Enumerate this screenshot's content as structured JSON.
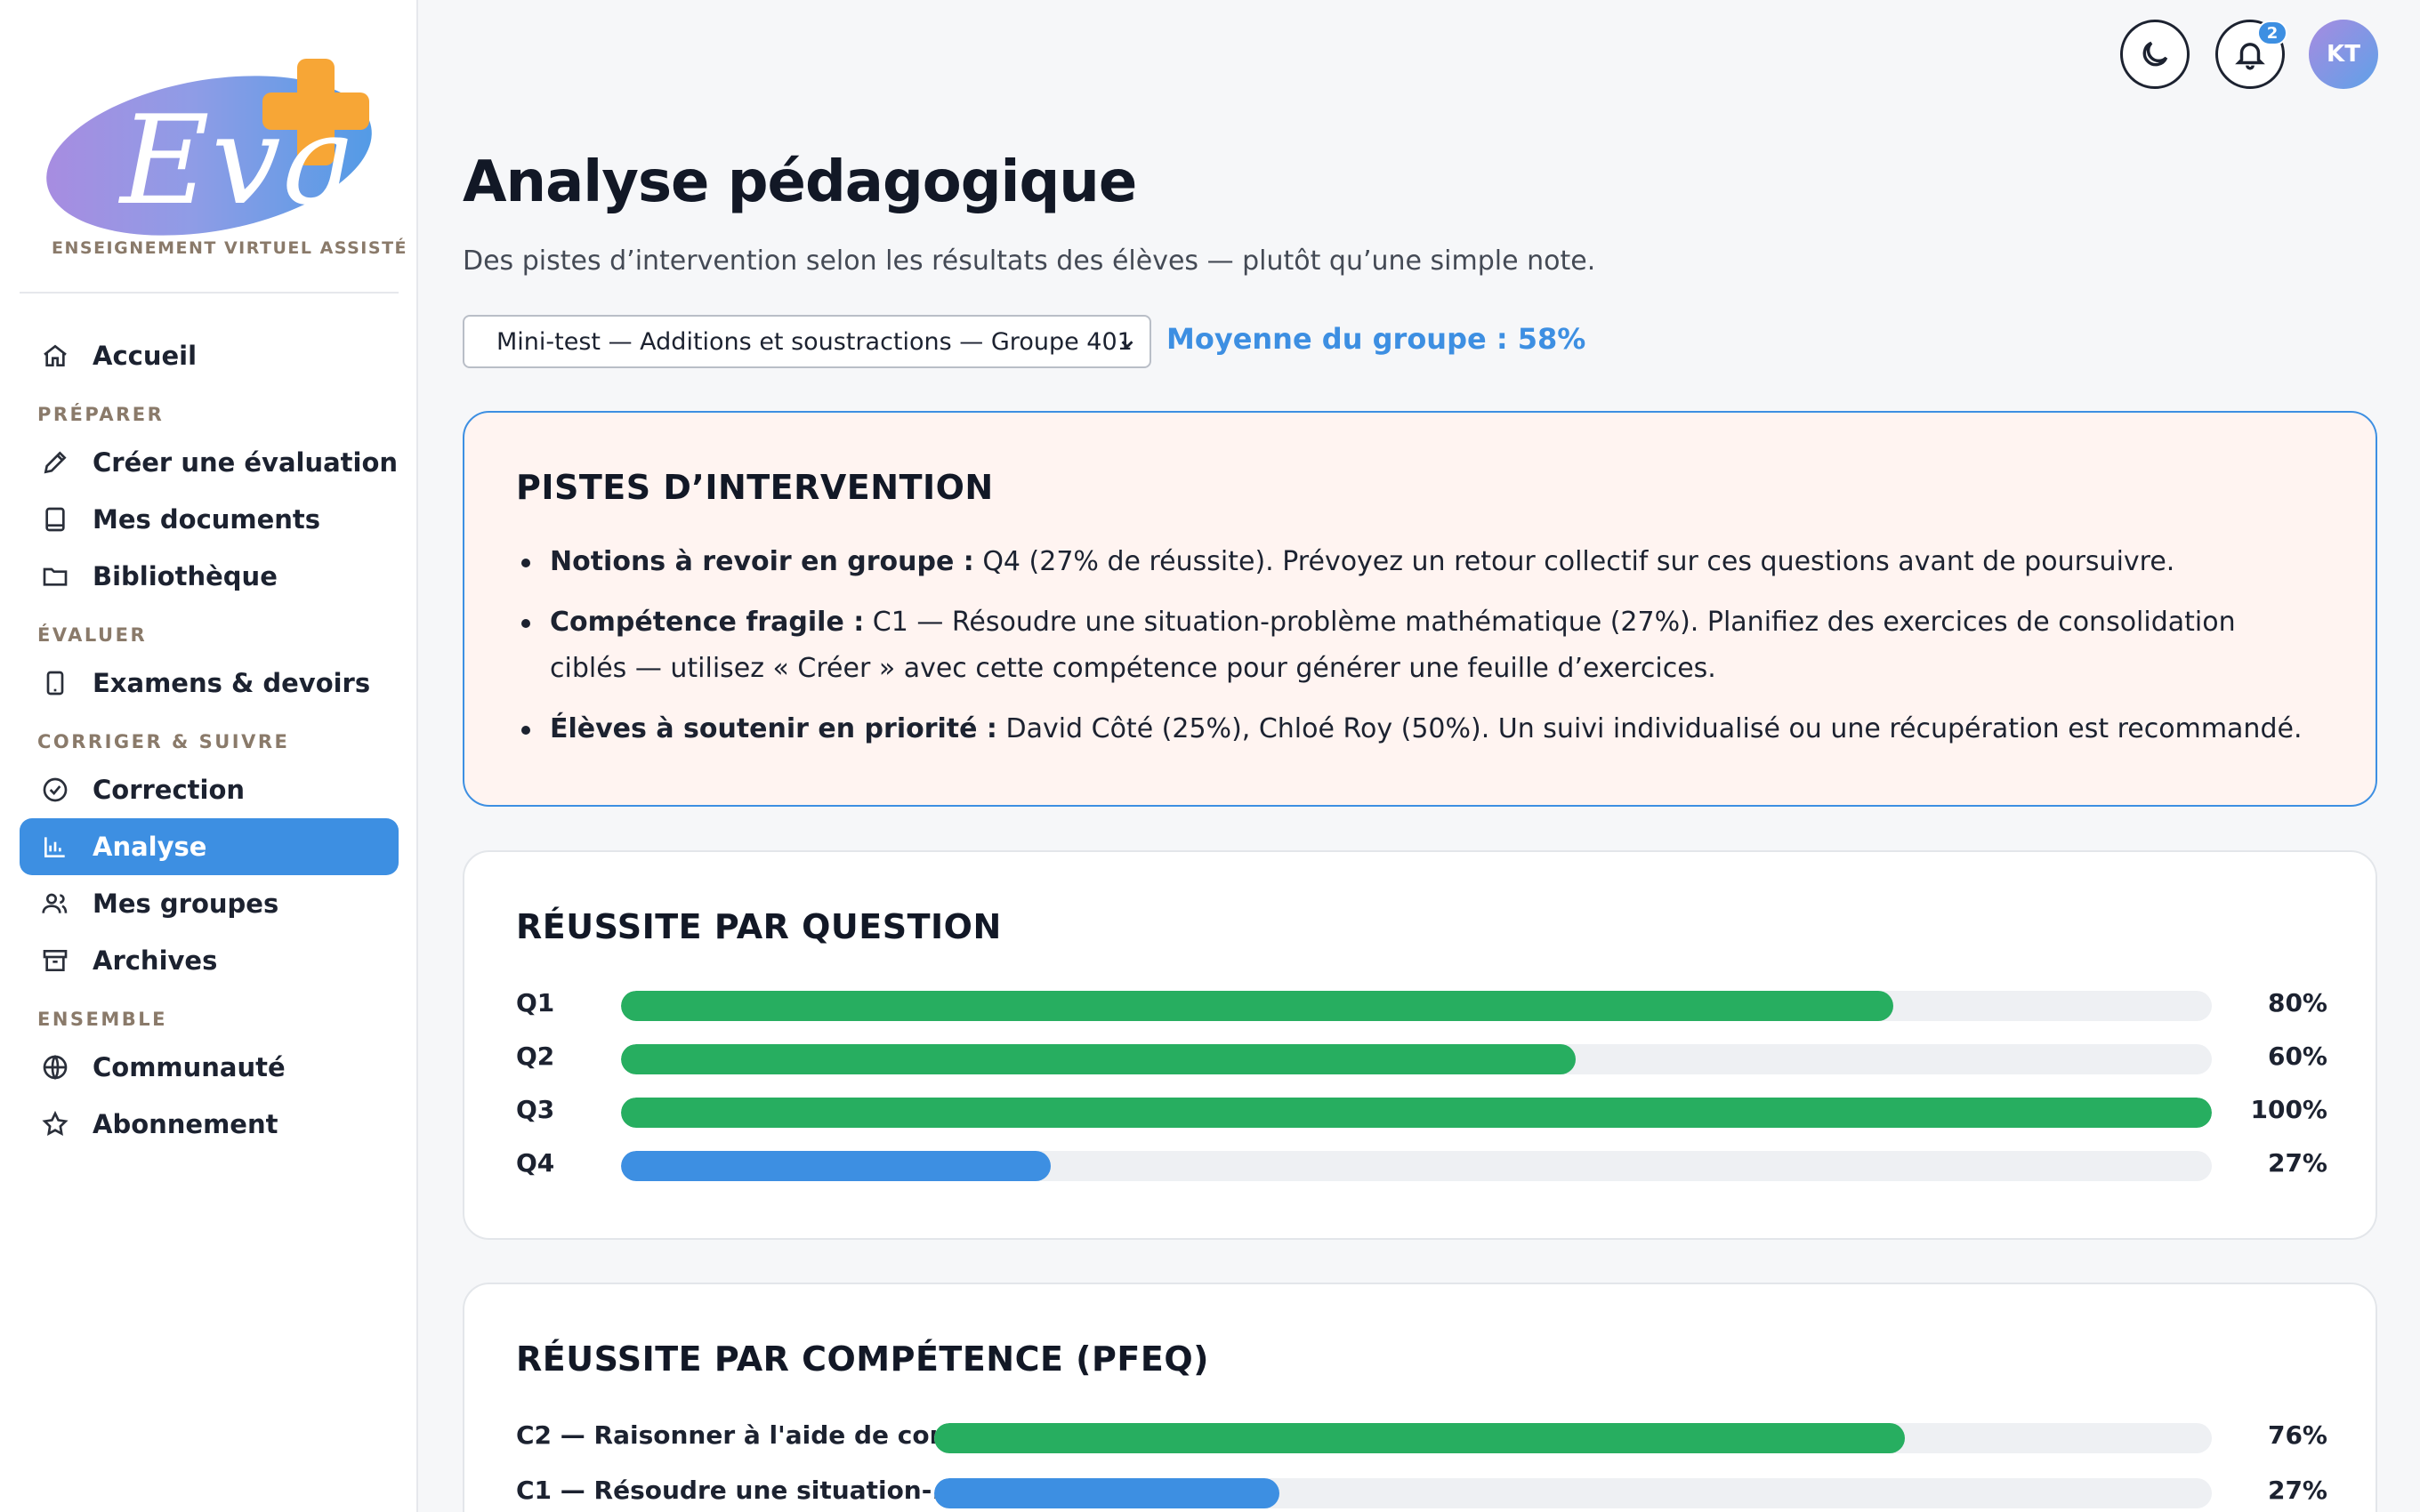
{
  "brand": {
    "logo_text": "Eva",
    "tagline": "ENSEIGNEMENT VIRTUEL ASSISTÉ"
  },
  "colors": {
    "accent": "#3d8fe2",
    "success": "#27ae60",
    "hint_bg": "#fff4f1"
  },
  "sidebar": {
    "home": {
      "label": "Accueil",
      "icon": "home-icon"
    },
    "sections": [
      {
        "title": "PRÉPARER",
        "items": [
          {
            "label": "Créer une évaluation",
            "icon": "pencil-icon"
          },
          {
            "label": "Mes documents",
            "icon": "book-icon"
          },
          {
            "label": "Bibliothèque",
            "icon": "folder-icon"
          }
        ]
      },
      {
        "title": "ÉVALUER",
        "items": [
          {
            "label": "Examens & devoirs",
            "icon": "tablet-icon"
          }
        ]
      },
      {
        "title": "CORRIGER & SUIVRE",
        "items": [
          {
            "label": "Correction",
            "icon": "check-circle-icon"
          },
          {
            "label": "Analyse",
            "icon": "bar-chart-icon",
            "active": true
          },
          {
            "label": "Mes groupes",
            "icon": "users-icon"
          },
          {
            "label": "Archives",
            "icon": "archive-icon"
          }
        ]
      },
      {
        "title": "ENSEMBLE",
        "items": [
          {
            "label": "Communauté",
            "icon": "globe-icon"
          },
          {
            "label": "Abonnement",
            "icon": "star-icon"
          }
        ]
      }
    ]
  },
  "topbar": {
    "notifications_count": "2",
    "avatar_initials": "KT"
  },
  "page": {
    "title": "Analyse pédagogique",
    "subtitle": "Des pistes d’intervention selon les résultats des élèves — plutôt qu’une simple note.",
    "selected_test": "Mini-test — Additions et soustractions — Groupe 401",
    "group_avg_label": "Moyenne du groupe : ",
    "group_avg_value": "58%"
  },
  "hints": {
    "title": "PISTES D’INTERVENTION",
    "items": [
      {
        "label": "Notions à revoir en groupe :",
        "text": " Q4 (27% de réussite). Prévoyez un retour collectif sur ces questions avant de poursuivre."
      },
      {
        "label": "Compétence fragile :",
        "text": " C1 — Résoudre une situation-problème mathématique (27%). Planifiez des exercices de consolidation ciblés — utilisez « Créer » avec cette compétence pour générer une feuille d’exercices."
      },
      {
        "label": "Élèves à soutenir en priorité :",
        "text": " David Côté (25%), Chloé Roy (50%). Un suivi individualisé ou une récupération est recommandé."
      }
    ]
  },
  "chart_data": [
    {
      "type": "bar",
      "title": "RÉUSSITE PAR QUESTION",
      "categories": [
        "Q1",
        "Q2",
        "Q3",
        "Q4"
      ],
      "values": [
        80,
        60,
        100,
        27
      ],
      "value_labels": [
        "80%",
        "60%",
        "100%",
        "27%"
      ],
      "colors": [
        "#27ae60",
        "#27ae60",
        "#27ae60",
        "#3d8fe2"
      ],
      "ylim": [
        0,
        100
      ]
    },
    {
      "type": "bar",
      "title": "RÉUSSITE PAR COMPÉTENCE (PFEQ)",
      "categories": [
        "C2 — Raisonner à l'aide de con...",
        "C1 — Résoudre une situation-..."
      ],
      "values": [
        76,
        27
      ],
      "value_labels": [
        "76%",
        "27%"
      ],
      "colors": [
        "#27ae60",
        "#3d8fe2"
      ],
      "ylim": [
        0,
        100
      ]
    }
  ]
}
